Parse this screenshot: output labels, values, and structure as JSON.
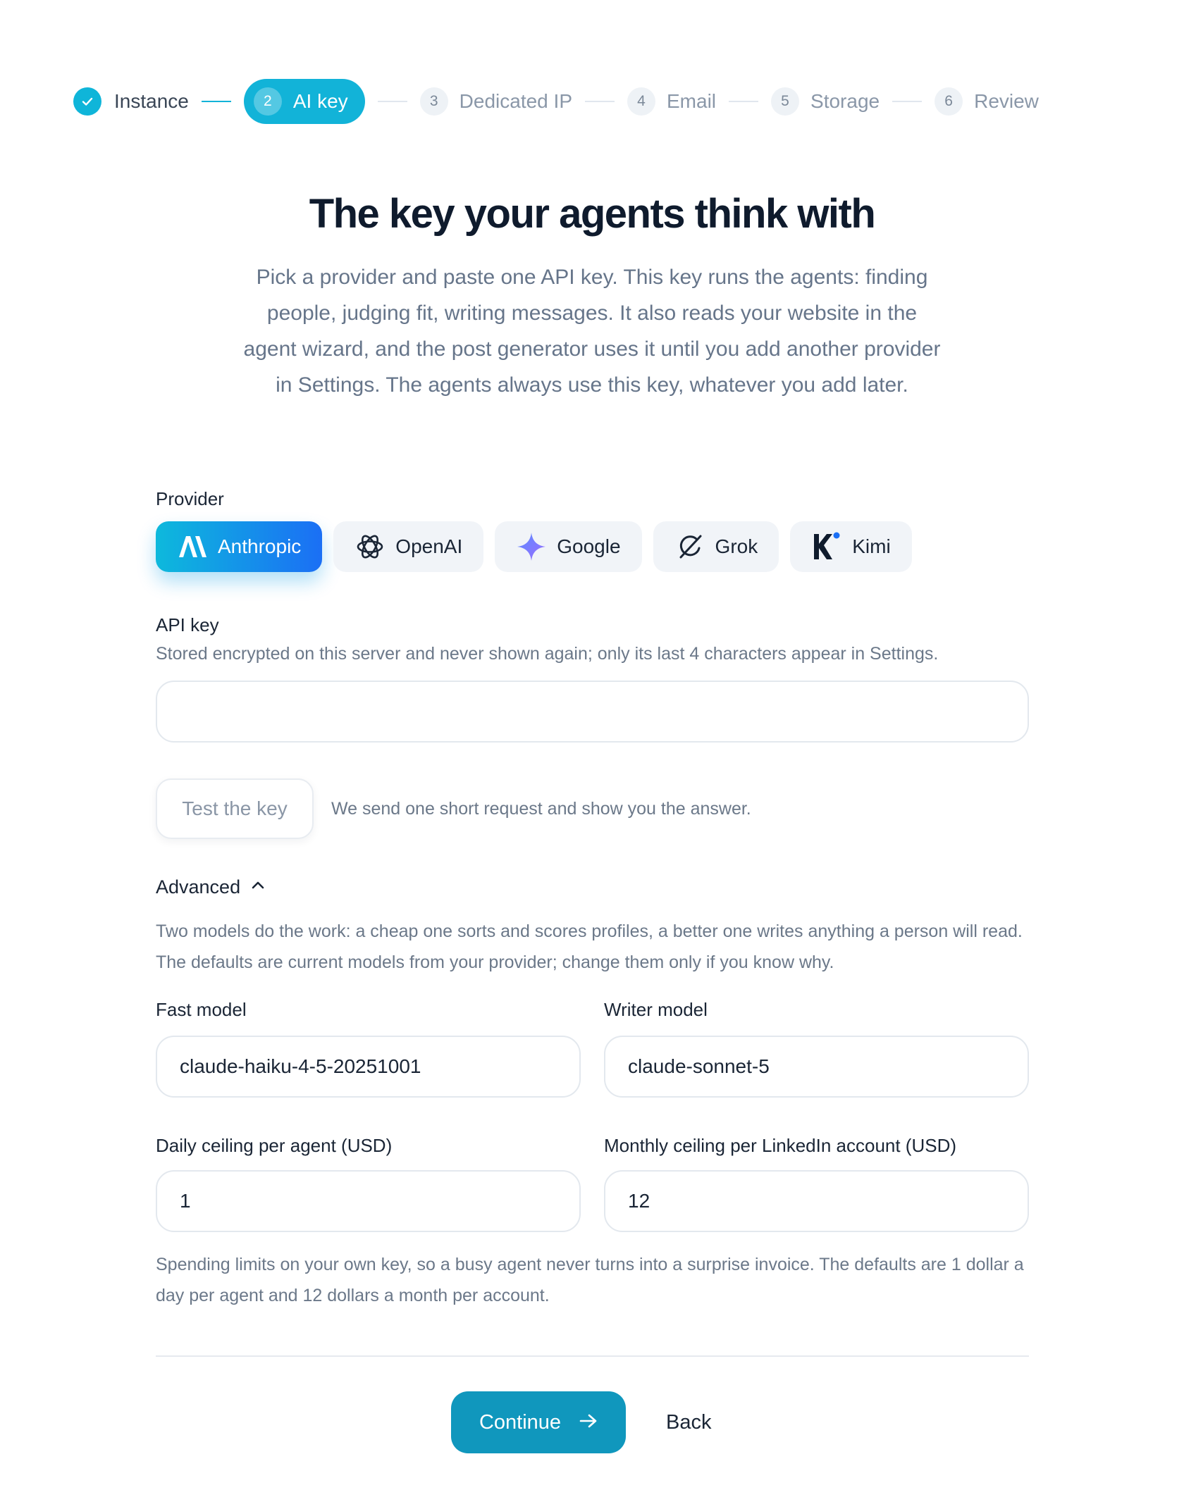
{
  "stepper": {
    "steps": [
      {
        "number": "1",
        "label": "Instance",
        "state": "done"
      },
      {
        "number": "2",
        "label": "AI key",
        "state": "active"
      },
      {
        "number": "3",
        "label": "Dedicated IP",
        "state": "pending"
      },
      {
        "number": "4",
        "label": "Email",
        "state": "pending"
      },
      {
        "number": "5",
        "label": "Storage",
        "state": "pending"
      },
      {
        "number": "6",
        "label": "Review",
        "state": "pending"
      }
    ]
  },
  "header": {
    "title": "The key your agents think with",
    "intro": "Pick a provider and paste one API key. This key runs the agents: finding people, judging fit, writing messages. It also reads your website in the agent wizard, and the post generator uses it until you add another provider in Settings. The agents always use this key, whatever you add later."
  },
  "provider": {
    "label": "Provider",
    "options": [
      {
        "name": "Anthropic",
        "icon": "anthropic-icon",
        "selected": true
      },
      {
        "name": "OpenAI",
        "icon": "openai-icon",
        "selected": false
      },
      {
        "name": "Google",
        "icon": "google-gemini-icon",
        "selected": false
      },
      {
        "name": "Grok",
        "icon": "grok-icon",
        "selected": false
      },
      {
        "name": "Kimi",
        "icon": "kimi-icon",
        "selected": false
      }
    ]
  },
  "api_key": {
    "label": "API key",
    "help": "Stored encrypted on this server and never shown again; only its last 4 characters appear in Settings.",
    "value": ""
  },
  "test": {
    "button_label": "Test the key",
    "help": "We send one short request and show you the answer."
  },
  "advanced": {
    "label": "Advanced",
    "expanded": true,
    "help": "Two models do the work: a cheap one sorts and scores profiles, a better one writes anything a person will read. The defaults are current models from your provider; change them only if you know why.",
    "fast_model": {
      "label": "Fast model",
      "value": "claude-haiku-4-5-20251001"
    },
    "writer_model": {
      "label": "Writer model",
      "value": "claude-sonnet-5"
    },
    "daily_ceiling": {
      "label": "Daily ceiling per agent (USD)",
      "value": "1"
    },
    "monthly_ceiling": {
      "label": "Monthly ceiling per LinkedIn account (USD)",
      "value": "12"
    },
    "ceiling_help": "Spending limits on your own key, so a busy agent never turns into a surprise invoice. The defaults are 1 dollar a day per agent and 12 dollars a month per account."
  },
  "actions": {
    "continue_label": "Continue",
    "back_label": "Back"
  },
  "colors": {
    "accent": "#12b3d8",
    "primary_button": "#1097bd",
    "selected_gradient_start": "#0db9dc",
    "selected_gradient_end": "#1b6ff5"
  }
}
